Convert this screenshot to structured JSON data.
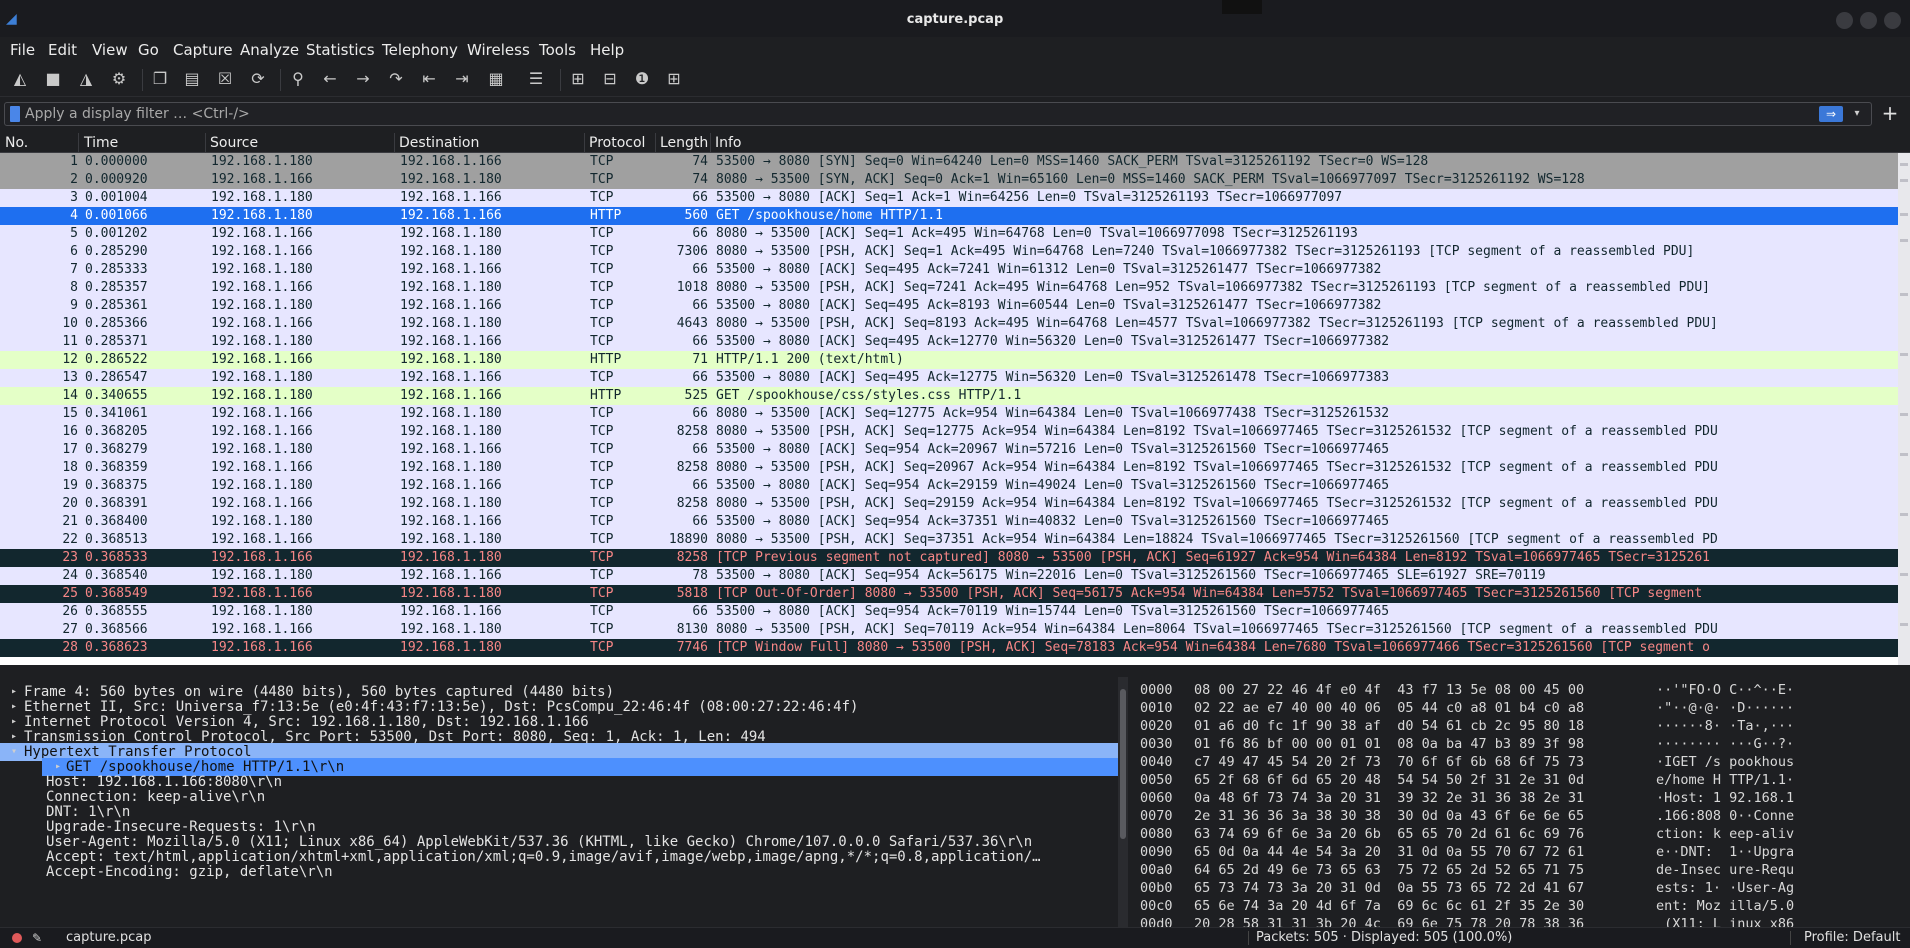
{
  "window": {
    "title": "capture.pcap"
  },
  "menu": [
    "File",
    "Edit",
    "View",
    "Go",
    "Capture",
    "Analyze",
    "Statistics",
    "Telephony",
    "Wireless",
    "Tools",
    "Help"
  ],
  "toolbar": {
    "icons": [
      "shark-fin-start-icon",
      "stop-square-icon",
      "shark-fin-restart-icon",
      "gear-options-icon",
      "open-file-icon",
      "file-save-icon",
      "close-file-icon",
      "reload-icon",
      "search-icon",
      "back-arrow-icon",
      "forward-arrow-icon",
      "jump-to-icon",
      "first-packet-icon",
      "last-packet-icon",
      "autoscroll-icon",
      "colorize-icon",
      "zoom-in-icon",
      "zoom-out-icon",
      "normal-size-icon",
      "resize-columns-icon"
    ]
  },
  "filter": {
    "placeholder": "Apply a display filter … <Ctrl-/>"
  },
  "columns": {
    "no": "No.",
    "time": "Time",
    "source": "Source",
    "destination": "Destination",
    "protocol": "Protocol",
    "length": "Length",
    "info": "Info"
  },
  "packets": [
    {
      "no": "1",
      "time": "0.000000",
      "src": "192.168.1.180",
      "dst": "192.168.1.166",
      "proto": "TCP",
      "len": "74",
      "info": "53500 → 8080 [SYN] Seq=0 Win=64240 Len=0 MSS=1460 SACK_PERM TSval=3125261192 TSecr=0 WS=128",
      "style": "syn"
    },
    {
      "no": "2",
      "time": "0.000920",
      "src": "192.168.1.166",
      "dst": "192.168.1.180",
      "proto": "TCP",
      "len": "74",
      "info": "8080 → 53500 [SYN, ACK] Seq=0 Ack=1 Win=65160 Len=0 MSS=1460 SACK_PERM TSval=1066977097 TSecr=3125261192 WS=128",
      "style": "syn"
    },
    {
      "no": "3",
      "time": "0.001004",
      "src": "192.168.1.180",
      "dst": "192.168.1.166",
      "proto": "TCP",
      "len": "66",
      "info": "53500 → 8080 [ACK] Seq=1 Ack=1 Win=64256 Len=0 TSval=3125261193 TSecr=1066977097",
      "style": "tcp"
    },
    {
      "no": "4",
      "time": "0.001066",
      "src": "192.168.1.180",
      "dst": "192.168.1.166",
      "proto": "HTTP",
      "len": "560",
      "info": "GET /spookhouse/home HTTP/1.1",
      "style": "sel"
    },
    {
      "no": "5",
      "time": "0.001202",
      "src": "192.168.1.166",
      "dst": "192.168.1.180",
      "proto": "TCP",
      "len": "66",
      "info": "8080 → 53500 [ACK] Seq=1 Ack=495 Win=64768 Len=0 TSval=1066977098 TSecr=3125261193",
      "style": "tcp"
    },
    {
      "no": "6",
      "time": "0.285290",
      "src": "192.168.1.166",
      "dst": "192.168.1.180",
      "proto": "TCP",
      "len": "7306",
      "info": "8080 → 53500 [PSH, ACK] Seq=1 Ack=495 Win=64768 Len=7240 TSval=1066977382 TSecr=3125261193 [TCP segment of a reassembled PDU]",
      "style": "tcp"
    },
    {
      "no": "7",
      "time": "0.285333",
      "src": "192.168.1.180",
      "dst": "192.168.1.166",
      "proto": "TCP",
      "len": "66",
      "info": "53500 → 8080 [ACK] Seq=495 Ack=7241 Win=61312 Len=0 TSval=3125261477 TSecr=1066977382",
      "style": "tcp"
    },
    {
      "no": "8",
      "time": "0.285357",
      "src": "192.168.1.166",
      "dst": "192.168.1.180",
      "proto": "TCP",
      "len": "1018",
      "info": "8080 → 53500 [PSH, ACK] Seq=7241 Ack=495 Win=64768 Len=952 TSval=1066977382 TSecr=3125261193 [TCP segment of a reassembled PDU]",
      "style": "tcp"
    },
    {
      "no": "9",
      "time": "0.285361",
      "src": "192.168.1.180",
      "dst": "192.168.1.166",
      "proto": "TCP",
      "len": "66",
      "info": "53500 → 8080 [ACK] Seq=495 Ack=8193 Win=60544 Len=0 TSval=3125261477 TSecr=1066977382",
      "style": "tcp"
    },
    {
      "no": "10",
      "time": "0.285366",
      "src": "192.168.1.166",
      "dst": "192.168.1.180",
      "proto": "TCP",
      "len": "4643",
      "info": "8080 → 53500 [PSH, ACK] Seq=8193 Ack=495 Win=64768 Len=4577 TSval=1066977382 TSecr=3125261193 [TCP segment of a reassembled PDU]",
      "style": "tcp"
    },
    {
      "no": "11",
      "time": "0.285371",
      "src": "192.168.1.180",
      "dst": "192.168.1.166",
      "proto": "TCP",
      "len": "66",
      "info": "53500 → 8080 [ACK] Seq=495 Ack=12770 Win=56320 Len=0 TSval=3125261477 TSecr=1066977382",
      "style": "tcp"
    },
    {
      "no": "12",
      "time": "0.286522",
      "src": "192.168.1.166",
      "dst": "192.168.1.180",
      "proto": "HTTP",
      "len": "71",
      "info": "HTTP/1.1 200   (text/html)",
      "style": "http"
    },
    {
      "no": "13",
      "time": "0.286547",
      "src": "192.168.1.180",
      "dst": "192.168.1.166",
      "proto": "TCP",
      "len": "66",
      "info": "53500 → 8080 [ACK] Seq=495 Ack=12775 Win=56320 Len=0 TSval=3125261478 TSecr=1066977383",
      "style": "tcp"
    },
    {
      "no": "14",
      "time": "0.340655",
      "src": "192.168.1.180",
      "dst": "192.168.1.166",
      "proto": "HTTP",
      "len": "525",
      "info": "GET /spookhouse/css/styles.css HTTP/1.1",
      "style": "http"
    },
    {
      "no": "15",
      "time": "0.341061",
      "src": "192.168.1.166",
      "dst": "192.168.1.180",
      "proto": "TCP",
      "len": "66",
      "info": "8080 → 53500 [ACK] Seq=12775 Ack=954 Win=64384 Len=0 TSval=1066977438 TSecr=3125261532",
      "style": "tcp"
    },
    {
      "no": "16",
      "time": "0.368205",
      "src": "192.168.1.166",
      "dst": "192.168.1.180",
      "proto": "TCP",
      "len": "8258",
      "info": "8080 → 53500 [PSH, ACK] Seq=12775 Ack=954 Win=64384 Len=8192 TSval=1066977465 TSecr=3125261532 [TCP segment of a reassembled PDU",
      "style": "tcp"
    },
    {
      "no": "17",
      "time": "0.368279",
      "src": "192.168.1.180",
      "dst": "192.168.1.166",
      "proto": "TCP",
      "len": "66",
      "info": "53500 → 8080 [ACK] Seq=954 Ack=20967 Win=57216 Len=0 TSval=3125261560 TSecr=1066977465",
      "style": "tcp"
    },
    {
      "no": "18",
      "time": "0.368359",
      "src": "192.168.1.166",
      "dst": "192.168.1.180",
      "proto": "TCP",
      "len": "8258",
      "info": "8080 → 53500 [PSH, ACK] Seq=20967 Ack=954 Win=64384 Len=8192 TSval=1066977465 TSecr=3125261532 [TCP segment of a reassembled PDU",
      "style": "tcp"
    },
    {
      "no": "19",
      "time": "0.368375",
      "src": "192.168.1.180",
      "dst": "192.168.1.166",
      "proto": "TCP",
      "len": "66",
      "info": "53500 → 8080 [ACK] Seq=954 Ack=29159 Win=49024 Len=0 TSval=3125261560 TSecr=1066977465",
      "style": "tcp"
    },
    {
      "no": "20",
      "time": "0.368391",
      "src": "192.168.1.166",
      "dst": "192.168.1.180",
      "proto": "TCP",
      "len": "8258",
      "info": "8080 → 53500 [PSH, ACK] Seq=29159 Ack=954 Win=64384 Len=8192 TSval=1066977465 TSecr=3125261532 [TCP segment of a reassembled PDU",
      "style": "tcp"
    },
    {
      "no": "21",
      "time": "0.368400",
      "src": "192.168.1.180",
      "dst": "192.168.1.166",
      "proto": "TCP",
      "len": "66",
      "info": "53500 → 8080 [ACK] Seq=954 Ack=37351 Win=40832 Len=0 TSval=3125261560 TSecr=1066977465",
      "style": "tcp"
    },
    {
      "no": "22",
      "time": "0.368513",
      "src": "192.168.1.166",
      "dst": "192.168.1.180",
      "proto": "TCP",
      "len": "18890",
      "info": "8080 → 53500 [PSH, ACK] Seq=37351 Ack=954 Win=64384 Len=18824 TSval=1066977465 TSecr=3125261560 [TCP segment of a reassembled PD",
      "style": "tcp"
    },
    {
      "no": "23",
      "time": "0.368533",
      "src": "192.168.1.166",
      "dst": "192.168.1.180",
      "proto": "TCP",
      "len": "8258",
      "info": "[TCP Previous segment not captured] 8080 → 53500 [PSH, ACK] Seq=61927 Ack=954 Win=64384 Len=8192 TSval=1066977465 TSecr=3125261",
      "style": "bad"
    },
    {
      "no": "24",
      "time": "0.368540",
      "src": "192.168.1.180",
      "dst": "192.168.1.166",
      "proto": "TCP",
      "len": "78",
      "info": "53500 → 8080 [ACK] Seq=954 Ack=56175 Win=22016 Len=0 TSval=3125261560 TSecr=1066977465 SLE=61927 SRE=70119",
      "style": "tcp"
    },
    {
      "no": "25",
      "time": "0.368549",
      "src": "192.168.1.166",
      "dst": "192.168.1.180",
      "proto": "TCP",
      "len": "5818",
      "info": "[TCP Out-Of-Order] 8080 → 53500 [PSH, ACK] Seq=56175 Ack=954 Win=64384 Len=5752 TSval=1066977465 TSecr=3125261560 [TCP segment",
      "style": "bad"
    },
    {
      "no": "26",
      "time": "0.368555",
      "src": "192.168.1.180",
      "dst": "192.168.1.166",
      "proto": "TCP",
      "len": "66",
      "info": "53500 → 8080 [ACK] Seq=954 Ack=70119 Win=15744 Len=0 TSval=3125261560 TSecr=1066977465",
      "style": "tcp"
    },
    {
      "no": "27",
      "time": "0.368566",
      "src": "192.168.1.166",
      "dst": "192.168.1.180",
      "proto": "TCP",
      "len": "8130",
      "info": "8080 → 53500 [PSH, ACK] Seq=70119 Ack=954 Win=64384 Len=8064 TSval=1066977465 TSecr=3125261560 [TCP segment of a reassembled PDU",
      "style": "tcp"
    },
    {
      "no": "28",
      "time": "0.368623",
      "src": "192.168.1.166",
      "dst": "192.168.1.180",
      "proto": "TCP",
      "len": "7746",
      "info": "[TCP Window Full] 8080 → 53500 [PSH, ACK] Seq=78183 Ack=954 Win=64384 Len=7680 TSval=1066977466 TSecr=3125261560 [TCP segment o",
      "style": "bad"
    }
  ],
  "details": [
    {
      "text": "Frame 4: 560 bytes on wire (4480 bits), 560 bytes captured (4480 bits)",
      "arrow": "▸",
      "indent": 0,
      "style": ""
    },
    {
      "text": "Ethernet II, Src: Universa_f7:13:5e (e0:4f:43:f7:13:5e), Dst: PcsCompu_22:46:4f (08:00:27:22:46:4f)",
      "arrow": "▸",
      "indent": 0,
      "style": ""
    },
    {
      "text": "Internet Protocol Version 4, Src: 192.168.1.180, Dst: 192.168.1.166",
      "arrow": "▸",
      "indent": 0,
      "style": ""
    },
    {
      "text": "Transmission Control Protocol, Src Port: 53500, Dst Port: 8080, Seq: 1, Ack: 1, Len: 494",
      "arrow": "▸",
      "indent": 0,
      "style": ""
    },
    {
      "text": "Hypertext Transfer Protocol",
      "arrow": "▾",
      "indent": 0,
      "style": "hl"
    },
    {
      "text": "GET /spookhouse/home HTTP/1.1\\r\\n",
      "arrow": "▸",
      "indent": 1,
      "style": "sel"
    },
    {
      "text": "Host: 192.168.1.166:8080\\r\\n",
      "arrow": "",
      "indent": 1,
      "style": ""
    },
    {
      "text": "Connection: keep-alive\\r\\n",
      "arrow": "",
      "indent": 1,
      "style": ""
    },
    {
      "text": "DNT: 1\\r\\n",
      "arrow": "",
      "indent": 1,
      "style": ""
    },
    {
      "text": "Upgrade-Insecure-Requests: 1\\r\\n",
      "arrow": "",
      "indent": 1,
      "style": ""
    },
    {
      "text": "User-Agent: Mozilla/5.0 (X11; Linux x86_64) AppleWebKit/537.36 (KHTML, like Gecko) Chrome/107.0.0.0 Safari/537.36\\r\\n",
      "arrow": "",
      "indent": 1,
      "style": ""
    },
    {
      "text": "Accept: text/html,application/xhtml+xml,application/xml;q=0.9,image/avif,image/webp,image/apng,*/*;q=0.8,application/…",
      "arrow": "",
      "indent": 1,
      "style": ""
    },
    {
      "text": "Accept-Encoding: gzip, deflate\\r\\n",
      "arrow": "",
      "indent": 1,
      "style": ""
    }
  ],
  "bytes": [
    {
      "off": "0000",
      "hex": "08 00 27 22 46 4f e0 4f  43 f7 13 5e 08 00 45 00",
      "asc": "··'\"FO·O C··^··E·"
    },
    {
      "off": "0010",
      "hex": "02 22 ae e7 40 00 40 06  05 44 c0 a8 01 b4 c0 a8",
      "asc": "·\"··@·@· ·D······"
    },
    {
      "off": "0020",
      "hex": "01 a6 d0 fc 1f 90 38 af  d0 54 61 cb 2c 95 80 18",
      "asc": "······8· ·Ta·,···"
    },
    {
      "off": "0030",
      "hex": "01 f6 86 bf 00 00 01 01  08 0a ba 47 b3 89 3f 98",
      "asc": "········ ···G··?·"
    },
    {
      "off": "0040",
      "hex": "c7 49 47 45 54 20 2f 73  70 6f 6f 6b 68 6f 75 73",
      "asc": "·IGET /s pookhous"
    },
    {
      "off": "0050",
      "hex": "65 2f 68 6f 6d 65 20 48  54 54 50 2f 31 2e 31 0d",
      "asc": "e/home H TTP/1.1·"
    },
    {
      "off": "0060",
      "hex": "0a 48 6f 73 74 3a 20 31  39 32 2e 31 36 38 2e 31",
      "asc": "·Host: 1 92.168.1"
    },
    {
      "off": "0070",
      "hex": "2e 31 36 36 3a 38 30 38  30 0d 0a 43 6f 6e 6e 65",
      "asc": ".166:808 0··Conne"
    },
    {
      "off": "0080",
      "hex": "63 74 69 6f 6e 3a 20 6b  65 65 70 2d 61 6c 69 76",
      "asc": "ction: k eep-aliv"
    },
    {
      "off": "0090",
      "hex": "65 0d 0a 44 4e 54 3a 20  31 0d 0a 55 70 67 72 61",
      "asc": "e··DNT:  1··Upgra"
    },
    {
      "off": "00a0",
      "hex": "64 65 2d 49 6e 73 65 63  75 72 65 2d 52 65 71 75",
      "asc": "de-Insec ure-Requ"
    },
    {
      "off": "00b0",
      "hex": "65 73 74 73 3a 20 31 0d  0a 55 73 65 72 2d 41 67",
      "asc": "ests: 1· ·User-Ag"
    },
    {
      "off": "00c0",
      "hex": "65 6e 74 3a 20 4d 6f 7a  69 6c 6c 61 2f 35 2e 30",
      "asc": "ent: Moz illa/5.0"
    },
    {
      "off": "00d0",
      "hex": "20 28 58 31 31 3b 20 4c  69 6e 75 78 20 78 38 36",
      "asc": " (X11; L inux x86"
    }
  ],
  "status": {
    "file": "capture.pcap",
    "packets": "Packets: 505 · Displayed: 505 (100.0%)",
    "profile": "Profile: Default"
  },
  "colors": {
    "tcp_row": "#e7e6ff",
    "syn_row": "#a0a0a0",
    "http_row": "#e4ffc7",
    "selected_row": "#1e6ff0",
    "bad_row_bg": "#12272e",
    "bad_row_fg": "#f78787"
  }
}
